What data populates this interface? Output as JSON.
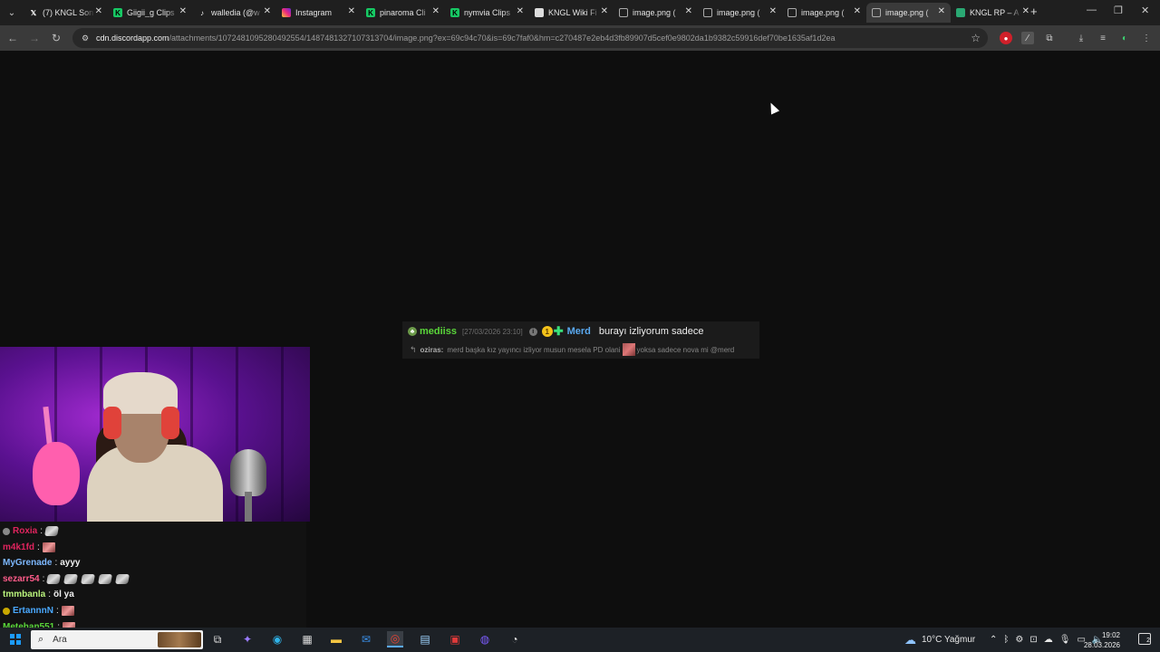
{
  "browser": {
    "tabs": [
      {
        "title": "(7) KNGL Son",
        "icon": "x-logo-icon"
      },
      {
        "title": "Giigii_g Clips",
        "icon": "kick-logo-icon"
      },
      {
        "title": "walledia (@w",
        "icon": "tiktok-logo-icon"
      },
      {
        "title": "Instagram",
        "icon": "instagram-logo-icon"
      },
      {
        "title": "pinaroma Cli",
        "icon": "kick-logo-icon"
      },
      {
        "title": "nymvia Clips",
        "icon": "kick-logo-icon"
      },
      {
        "title": "KNGL Wiki Fi",
        "icon": "shield-icon"
      },
      {
        "title": "image.png (",
        "icon": "globe-icon"
      },
      {
        "title": "image.png (",
        "icon": "globe-icon"
      },
      {
        "title": "image.png (",
        "icon": "globe-icon"
      },
      {
        "title": "image.png (",
        "icon": "globe-icon",
        "active": true
      },
      {
        "title": "KNGL RP – A",
        "icon": "kngl-rp-icon"
      }
    ],
    "url_host": "cdn.discordapp.com",
    "url_rest": "/attachments/1072481095280492554/1487481327107313704/image.png?ex=69c94c70&is=69c7faf0&hm=c270487e2eb4d3fb89907d5cef0e9802da1b9382c59916def70be1635af1d2ea"
  },
  "chat_card": {
    "username": "mediiss",
    "timestamp": "[27/03/2026 23:10]",
    "badge_number": "1",
    "reply_to_name": "Merd",
    "message": "burayı izliyorum sadece",
    "quoted_user": "oziras:",
    "quoted_text_1": "merd başka kız yayıncı izliyor musun mesela PD olani",
    "quoted_text_2": "yoksa sadece nova mi @merd"
  },
  "stream_chat": [
    {
      "name": "Roxia",
      "color": "#e0245e",
      "badge": true,
      "badge_color": "#888888",
      "text": "",
      "emotes": 1,
      "emote_type": "gray"
    },
    {
      "name": "m4k1fd",
      "color": "#e0245e",
      "badge": false,
      "text": "",
      "emotes": 1,
      "emote_type": "red"
    },
    {
      "name": "MyGrenade",
      "color": "#7db8ff",
      "badge": false,
      "text": "ayyy",
      "emotes": 0
    },
    {
      "name": "sezarr54",
      "color": "#ff5c8a",
      "badge": false,
      "text": "",
      "emotes": 5,
      "emote_type": "gray"
    },
    {
      "name": "tmmbanla",
      "color": "#b9f27c",
      "badge": false,
      "text": "öl ya",
      "emotes": 0
    },
    {
      "name": "ErtannnN",
      "color": "#4aa9ff",
      "badge": true,
      "badge_color": "#c9a800",
      "text": "",
      "emotes": 1,
      "emote_type": "red"
    },
    {
      "name": "Metehan551",
      "color": "#5ad63a",
      "badge": false,
      "text": "",
      "emotes": 1,
      "emote_type": "red"
    }
  ],
  "taskbar": {
    "search_placeholder": "Ara",
    "weather": "10°C  Yağmur",
    "time": "19:02",
    "date": "28.03.2026",
    "notification_count": "2"
  }
}
